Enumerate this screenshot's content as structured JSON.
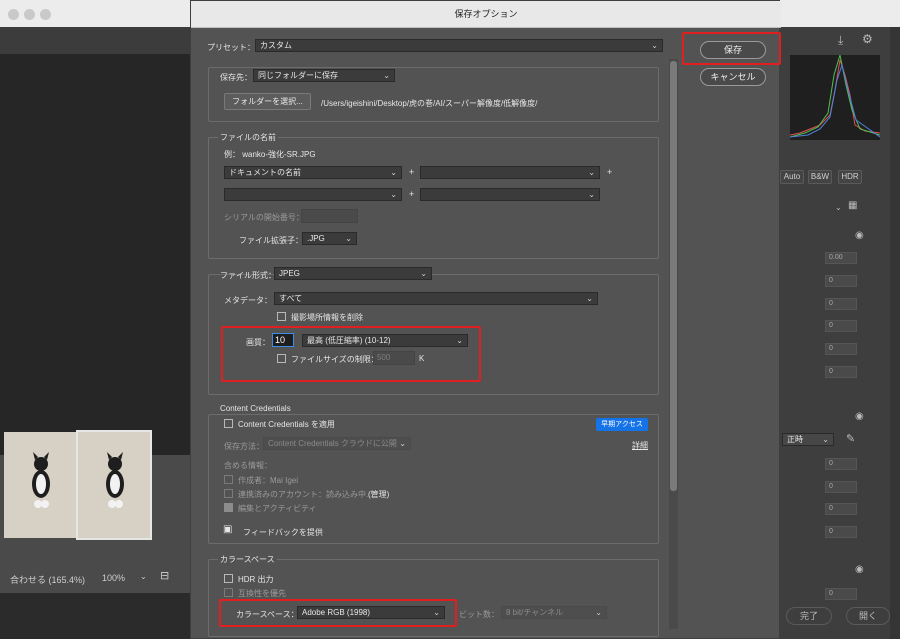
{
  "dialog": {
    "title": "保存オプション",
    "preset_label": "プリセット：",
    "preset_value": "カスタム",
    "save_button": "保存",
    "cancel_button": "キャンセル"
  },
  "destination": {
    "label": "保存先：",
    "value": "同じフォルダーに保存",
    "choose_button": "フォルダーを選択...",
    "path": "/Users/igeishini/Desktop/虎の巻/AI/スーパー解像度/低解像度/"
  },
  "file_naming": {
    "title": "ファイルの名前",
    "example": "例： wanko-強化-SR.JPG",
    "field1": "ドキュメントの名前",
    "field2": "",
    "field3": "",
    "field4": "",
    "plus": "+",
    "serial_label": "シリアルの開始番号：",
    "ext_label": "ファイル拡張子：",
    "ext_value": ".JPG"
  },
  "file_settings": {
    "format_label": "ファイル形式：",
    "format_value": "JPEG",
    "metadata_label": "メタデータ：",
    "metadata_value": "すべて",
    "remove_location": "撮影場所情報を削除",
    "quality_label": "画質：",
    "quality_value": "10",
    "quality_preset": "最高 (低圧縮率) (10-12)",
    "limit_size_label": "ファイルサイズの制限：",
    "limit_size_value": "500",
    "limit_unit": "K"
  },
  "content_credentials": {
    "title": "Content Credentials",
    "apply_label": "Content Credentials を適用",
    "early_access": "早期アクセス",
    "details_link": "詳細",
    "save_method_label": "保存方法：",
    "save_method_value": "Content Credentials クラウドに公開",
    "include_label": "含める情報：",
    "creator": "作成者：Mai Igei",
    "linked_accounts": "連携済みのアカウント：読み込み中...",
    "manage_link": "(管理)",
    "edits_activity": "編集とアクティビティ",
    "feedback": "フィードバックを提供"
  },
  "color_space": {
    "title": "カラースペース",
    "hdr_output": "HDR 出力",
    "compat_priority": "互換性を優先",
    "space_label": "カラースペース：",
    "space_value": "Adobe RGB (1998)",
    "bit_depth_label": "ビット数：",
    "bit_depth_value": "8 bit/チャンネル"
  },
  "background_app": {
    "zoom_label": "合わせる (165.4%)",
    "zoom_percent": "100%",
    "auto": "Auto",
    "bw": "B&W",
    "hdr": "HDR",
    "field_value": "0.00",
    "zero": "0",
    "time_label": "正時",
    "done_button": "完了",
    "open_button": "開く"
  },
  "colors": {
    "highlight_red": "#e02020",
    "early_access_blue": "#1473e6",
    "dialog_bg": "#535353"
  }
}
